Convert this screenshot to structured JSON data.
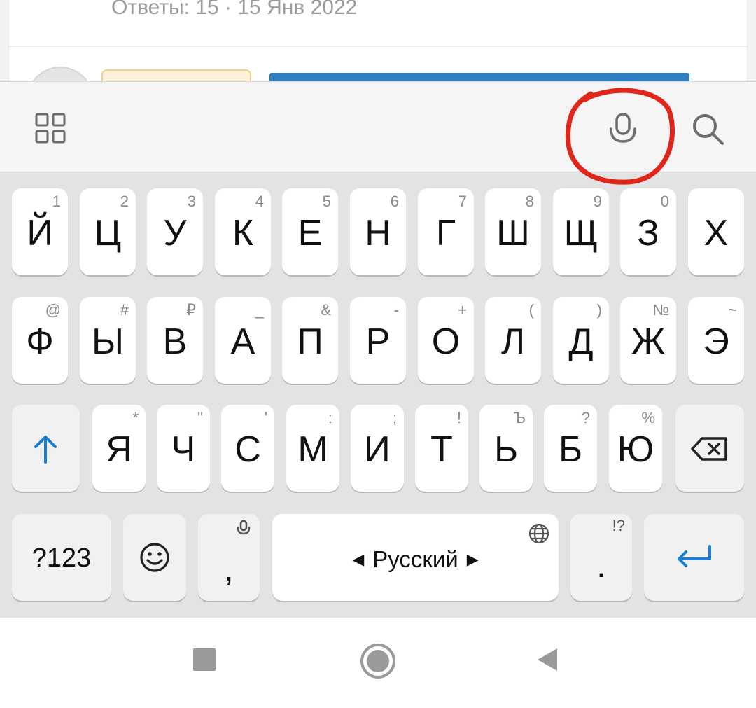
{
  "background": {
    "answers_meta": "Ответы: 15 · 15 Янв 2022"
  },
  "toolbar": {
    "icons": [
      "apps-grid-icon",
      "microphone-icon",
      "search-icon"
    ],
    "annotation_color": "#e0261b"
  },
  "keyboard": {
    "row1": [
      {
        "label": "Й",
        "hint": "1"
      },
      {
        "label": "Ц",
        "hint": "2"
      },
      {
        "label": "У",
        "hint": "3"
      },
      {
        "label": "К",
        "hint": "4"
      },
      {
        "label": "Е",
        "hint": "5"
      },
      {
        "label": "Н",
        "hint": "6"
      },
      {
        "label": "Г",
        "hint": "7"
      },
      {
        "label": "Ш",
        "hint": "8"
      },
      {
        "label": "Щ",
        "hint": "9"
      },
      {
        "label": "З",
        "hint": "0"
      },
      {
        "label": "Х",
        "hint": ""
      }
    ],
    "row2": [
      {
        "label": "Ф",
        "hint": "@"
      },
      {
        "label": "Ы",
        "hint": "#"
      },
      {
        "label": "В",
        "hint": "₽"
      },
      {
        "label": "А",
        "hint": "_"
      },
      {
        "label": "П",
        "hint": "&"
      },
      {
        "label": "Р",
        "hint": "-"
      },
      {
        "label": "О",
        "hint": "+"
      },
      {
        "label": "Л",
        "hint": "("
      },
      {
        "label": "Д",
        "hint": ")"
      },
      {
        "label": "Ж",
        "hint": "№"
      },
      {
        "label": "Э",
        "hint": "~"
      }
    ],
    "row3": [
      {
        "label": "Я",
        "hint": "*"
      },
      {
        "label": "Ч",
        "hint": "\""
      },
      {
        "label": "С",
        "hint": "'"
      },
      {
        "label": "М",
        "hint": ":"
      },
      {
        "label": "И",
        "hint": ";"
      },
      {
        "label": "Т",
        "hint": "!"
      },
      {
        "label": "Ь",
        "hint": "Ъ"
      },
      {
        "label": "Б",
        "hint": "?"
      },
      {
        "label": "Ю",
        "hint": "%"
      }
    ],
    "symbols_key": "?123",
    "comma_key": ",",
    "space_label": "Русский",
    "period_key": ".",
    "period_hint": "!?",
    "accent_color": "#1a7fd4"
  }
}
